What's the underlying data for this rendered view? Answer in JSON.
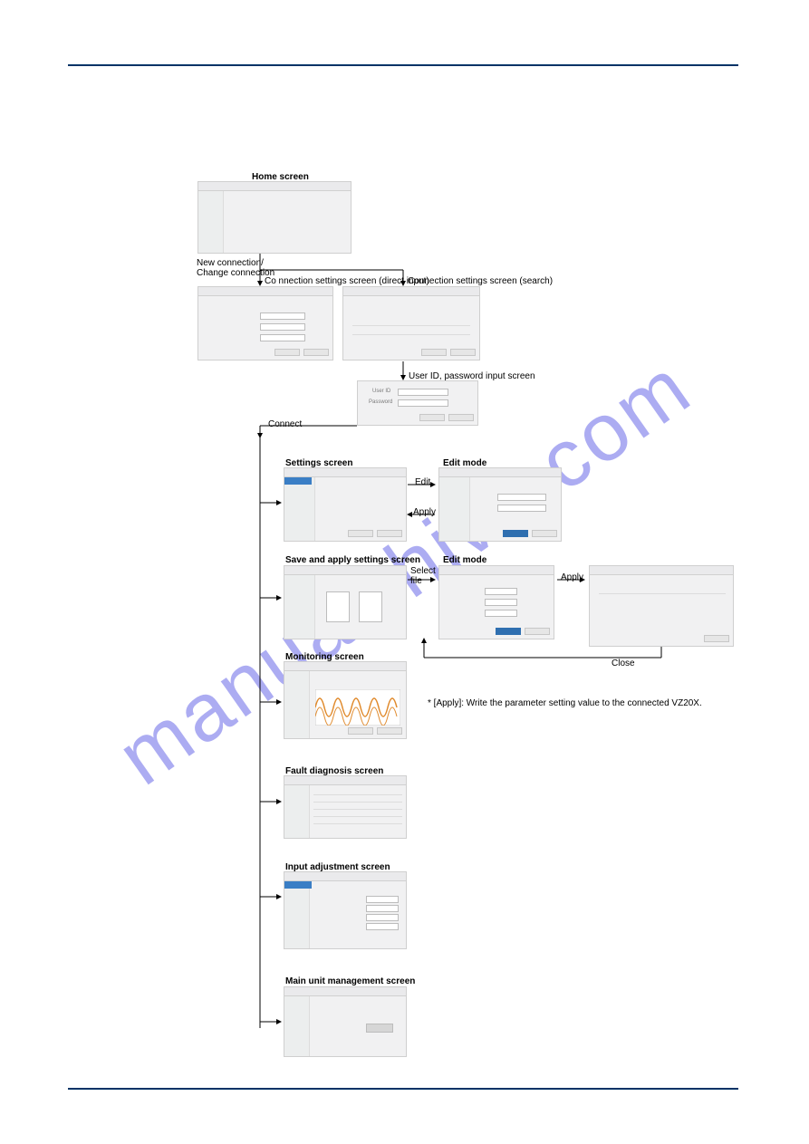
{
  "watermark": "manualshive.com",
  "labels": {
    "home": "Home screen",
    "new_change": "New connection/\nChange connection",
    "conn_direct": "Co nnection settings screen (direct input)",
    "conn_search": "Connection settings screen (search)",
    "user_pw": "User ID, password input screen",
    "connect": "Connect",
    "settings": "Settings screen",
    "edit_mode": "Edit mode",
    "edit": "Edit",
    "apply": "Apply",
    "save_apply": "Save and apply settings screen",
    "select_file": "Select\nfile",
    "apply2": "Apply",
    "close": "Close",
    "monitoring": "Monitoring screen",
    "fault": "Fault diagnosis screen",
    "input_adj": "Input adjustment screen",
    "main_unit": "Main unit management screen",
    "footnote": "* [Apply]: Write the parameter setting value to the connected VZ20X.",
    "user_id": "User ID",
    "password": "Password"
  }
}
